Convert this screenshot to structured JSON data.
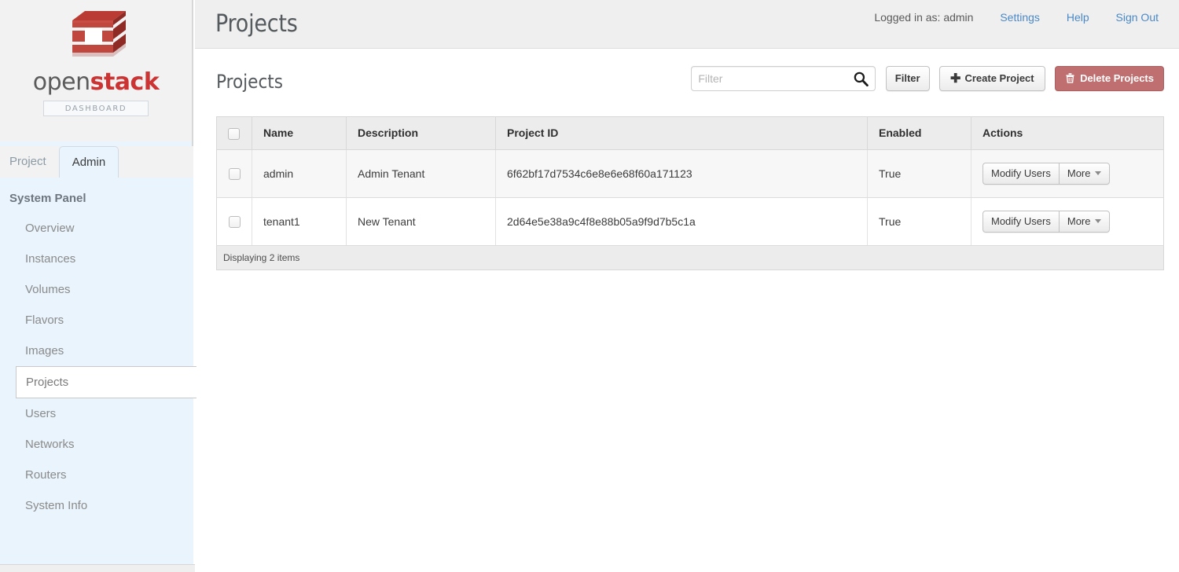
{
  "brand": {
    "logo_icon": "openstack-cube-logo",
    "wordmark_open": "open",
    "wordmark_stack": "stack",
    "tagline": "DASHBOARD",
    "logo_color": "#c0392b",
    "accent_color": "#cc3333"
  },
  "tabs": [
    {
      "label": "Project",
      "active": false
    },
    {
      "label": "Admin",
      "active": true
    }
  ],
  "sidebar": {
    "panel_title": "System Panel",
    "items": [
      {
        "label": "Overview",
        "active": false
      },
      {
        "label": "Instances",
        "active": false
      },
      {
        "label": "Volumes",
        "active": false
      },
      {
        "label": "Flavors",
        "active": false
      },
      {
        "label": "Images",
        "active": false
      },
      {
        "label": "Projects",
        "active": true
      },
      {
        "label": "Users",
        "active": false
      },
      {
        "label": "Networks",
        "active": false
      },
      {
        "label": "Routers",
        "active": false
      },
      {
        "label": "System Info",
        "active": false
      }
    ]
  },
  "topbar": {
    "page_title": "Projects",
    "logged_in_as": "Logged in as: admin",
    "links": [
      {
        "label": "Settings"
      },
      {
        "label": "Help"
      },
      {
        "label": "Sign Out"
      }
    ],
    "link_color": "#4a89c8"
  },
  "main": {
    "section_title": "Projects",
    "filter": {
      "placeholder": "Filter",
      "value": "",
      "icon": "search-icon"
    },
    "buttons": {
      "filter": "Filter",
      "create": "Create Project",
      "create_icon": "plus-icon",
      "delete": "Delete Projects",
      "delete_icon": "trash-icon",
      "delete_color": "#bf6f6f"
    },
    "table": {
      "columns": [
        "",
        "Name",
        "Description",
        "Project ID",
        "Enabled",
        "Actions"
      ],
      "rows": [
        {
          "selected": false,
          "name": "admin",
          "description": "Admin Tenant",
          "project_id": "6f62bf17d7534c6e8e6e68f60a171123",
          "enabled": "True",
          "actions": {
            "primary": "Modify Users",
            "more": "More"
          }
        },
        {
          "selected": false,
          "name": "tenant1",
          "description": "New Tenant",
          "project_id": "2d64e5e38a9c4f8e88b05a9f9d7b5c1a",
          "enabled": "True",
          "actions": {
            "primary": "Modify Users",
            "more": "More"
          }
        }
      ],
      "footer": "Displaying 2 items"
    }
  }
}
